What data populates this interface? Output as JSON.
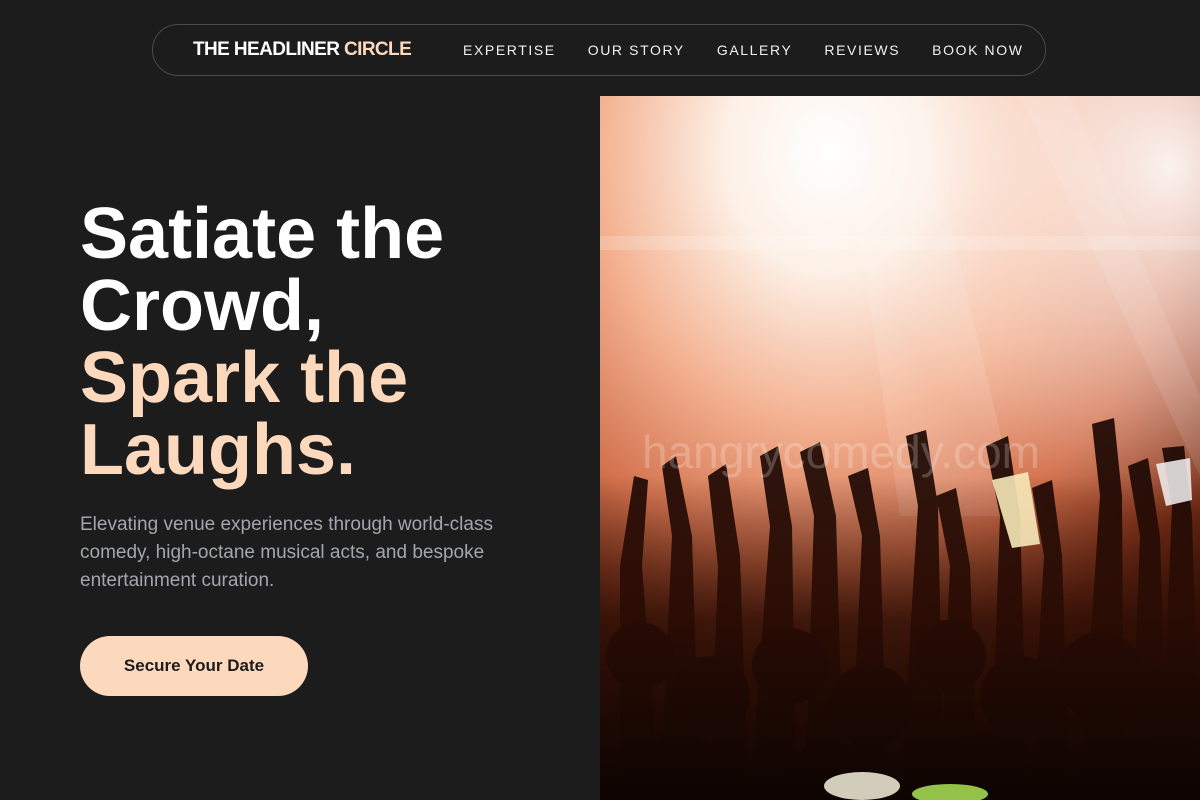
{
  "brand": {
    "name": "THE HEADLINER",
    "accent": "CIRCLE"
  },
  "nav": {
    "links": [
      "EXPERTISE",
      "OUR STORY",
      "GALLERY",
      "REVIEWS",
      "BOOK NOW"
    ]
  },
  "hero": {
    "title_line1": "Satiate the",
    "title_line2": "Crowd,",
    "title_line3": "Spark the",
    "title_line4": "Laughs.",
    "subtitle": "Elevating venue experiences through world-class comedy, high-octane musical acts, and bespoke entertainment curation.",
    "cta_label": "Secure Your Date",
    "image_watermark": "hangrycomedy.com"
  },
  "colors": {
    "background": "#1c1c1d",
    "accent": "#fcd9bd",
    "text": "#ffffff",
    "muted": "#a3a6ad"
  }
}
